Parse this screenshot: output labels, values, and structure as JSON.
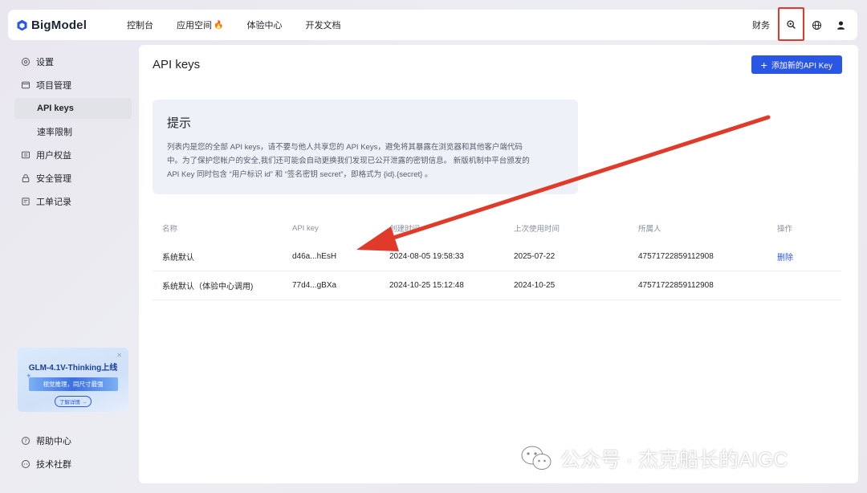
{
  "brand": {
    "name": "BigModel",
    "color": "#2a56e6"
  },
  "topnav": {
    "items": [
      {
        "label": "控制台"
      },
      {
        "label": "应用空间",
        "badge_icon": "fire-icon"
      },
      {
        "label": "体验中心"
      },
      {
        "label": "开发文档"
      }
    ],
    "finance_label": "财务",
    "right_icons": [
      "support-icon",
      "globe-icon",
      "user-icon"
    ]
  },
  "sidebar": {
    "items": [
      {
        "label": "设置",
        "icon": "gear-icon"
      },
      {
        "label": "项目管理",
        "icon": "folder-icon"
      },
      {
        "label": "API keys",
        "active": true,
        "sub": true
      },
      {
        "label": "速率限制",
        "sub": true
      },
      {
        "label": "用户权益",
        "icon": "benefit-icon"
      },
      {
        "label": "安全管理",
        "icon": "lock-icon"
      },
      {
        "label": "工单记录",
        "icon": "ticket-icon"
      }
    ],
    "promo": {
      "title": "GLM-4.1V-Thinking上线",
      "subtitle": "视觉推理，同尺寸最强",
      "button": "了解详情 →"
    },
    "bottom_items": [
      {
        "label": "帮助中心",
        "icon": "help-icon"
      },
      {
        "label": "技术社群",
        "icon": "chat-icon"
      }
    ]
  },
  "main": {
    "title": "API keys",
    "add_button": "添加新的API Key",
    "tip": {
      "title": "提示",
      "line1": "列表内是您的全部 API keys，请不要与他人共享您的 API Keys，避免将其暴露在浏览器和其他客户端代码",
      "line2": "中。为了保护您帐户的安全,我们还可能会自动更换我们发现已公开泄露的密钥信息。 新版机制中平台颁发的",
      "line3": "API Key 同时包含 “用户标识 id” 和 “签名密钥 secret”，即格式为 {id}.{secret} 。"
    },
    "table": {
      "headers": [
        "名称",
        "API key",
        "创建时间",
        "上次使用时间",
        "所属人",
        "操作"
      ],
      "rows": [
        {
          "name": "系统默认",
          "key": "d46a...hEsH",
          "created": "2024-08-05 19:58:33",
          "last_used": "2025-07-22",
          "owner": "47571722859112908",
          "action": "删除"
        },
        {
          "name": "系统默认（体验中心调用)",
          "key": "77d4...gBXa",
          "created": "2024-10-25 15:12:48",
          "last_used": "2024-10-25",
          "owner": "47571722859112908",
          "action": ""
        }
      ]
    }
  },
  "annotation": {
    "color": "#e03a2b"
  },
  "watermark": {
    "text": "公众号 · 杰克船长的AIGC"
  }
}
